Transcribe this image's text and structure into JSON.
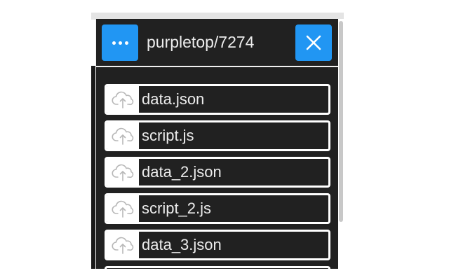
{
  "panel": {
    "title": "purpletop/7274",
    "menu_button": {
      "icon": "more-horizontal-icon"
    },
    "close_button": {
      "icon": "close-icon"
    },
    "accent_color": "#2196f3",
    "background_color": "#212121"
  },
  "files": {
    "icon": "cloud-upload-icon",
    "items": [
      {
        "name": "data.json"
      },
      {
        "name": "script.js"
      },
      {
        "name": "data_2.json"
      },
      {
        "name": "script_2.js"
      },
      {
        "name": "data_3.json"
      }
    ]
  }
}
